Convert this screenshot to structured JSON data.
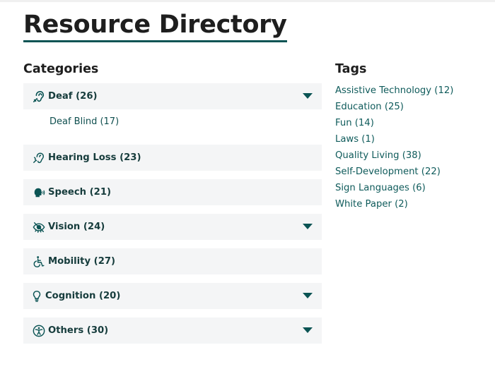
{
  "page": {
    "title": "Resource Directory"
  },
  "categories": {
    "heading": "Categories",
    "items": [
      {
        "label": "Deaf (26)",
        "icon": "ear-icon",
        "expandable": true,
        "children": [
          {
            "label": "Deaf Blind (17)"
          }
        ]
      },
      {
        "label": "Hearing Loss (23)",
        "icon": "hearing-loss-icon",
        "expandable": false
      },
      {
        "label": "Speech (21)",
        "icon": "speaking-head-icon",
        "expandable": false
      },
      {
        "label": "Vision (24)",
        "icon": "low-vision-icon",
        "expandable": true
      },
      {
        "label": "Mobility (27)",
        "icon": "wheelchair-icon",
        "expandable": false
      },
      {
        "label": "Cognition (20)",
        "icon": "lightbulb-icon",
        "expandable": true
      },
      {
        "label": "Others (30)",
        "icon": "accessibility-icon",
        "expandable": true
      }
    ]
  },
  "tags": {
    "heading": "Tags",
    "items": [
      "Assistive Technology (12)",
      "Education (25)",
      "Fun (14)",
      "Laws (1)",
      "Quality Living (38)",
      "Self-Development (22)",
      "Sign Languages (6)",
      "White Paper (2)"
    ]
  },
  "colors": {
    "accent": "#0b5454",
    "panel_bg": "#f4f5f6",
    "link": "#0f5b5b"
  }
}
